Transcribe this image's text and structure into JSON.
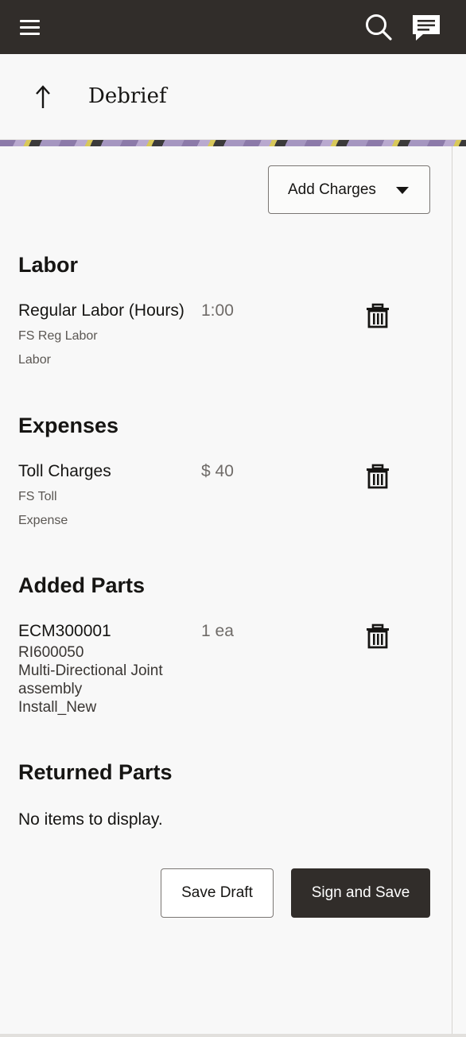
{
  "header": {
    "title": "Debrief"
  },
  "icons": {
    "menu": "hamburger-icon",
    "search": "search-icon",
    "chat": "chat-icon",
    "back": "arrow-up-icon",
    "delete": "trash-icon",
    "dropdown": "caret-down-icon"
  },
  "colors": {
    "topbar": "#312d2a",
    "primary_button": "#312d2a",
    "background": "#f8f8f8"
  },
  "actions": {
    "add_charges_label": "Add Charges"
  },
  "labor": {
    "title": "Labor",
    "items": [
      {
        "name": "Regular Labor (Hours)",
        "quantity": "1:00",
        "line1": "FS Reg Labor",
        "line2": "Labor"
      }
    ]
  },
  "expenses": {
    "title": "Expenses",
    "items": [
      {
        "name": "Toll Charges",
        "quantity": "$ 40",
        "line1": "FS Toll",
        "line2": "Expense"
      }
    ]
  },
  "added_parts": {
    "title": "Added Parts",
    "items": [
      {
        "name": "ECM300001",
        "quantity": "1 ea",
        "line1": "RI600050",
        "line2": "Multi-Directional Joint",
        "line3": "assembly",
        "line4": "Install_New"
      }
    ]
  },
  "returned_parts": {
    "title": "Returned Parts",
    "empty_text": "No items to display."
  },
  "footer": {
    "save_draft_label": "Save Draft",
    "sign_save_label": "Sign and Save"
  }
}
